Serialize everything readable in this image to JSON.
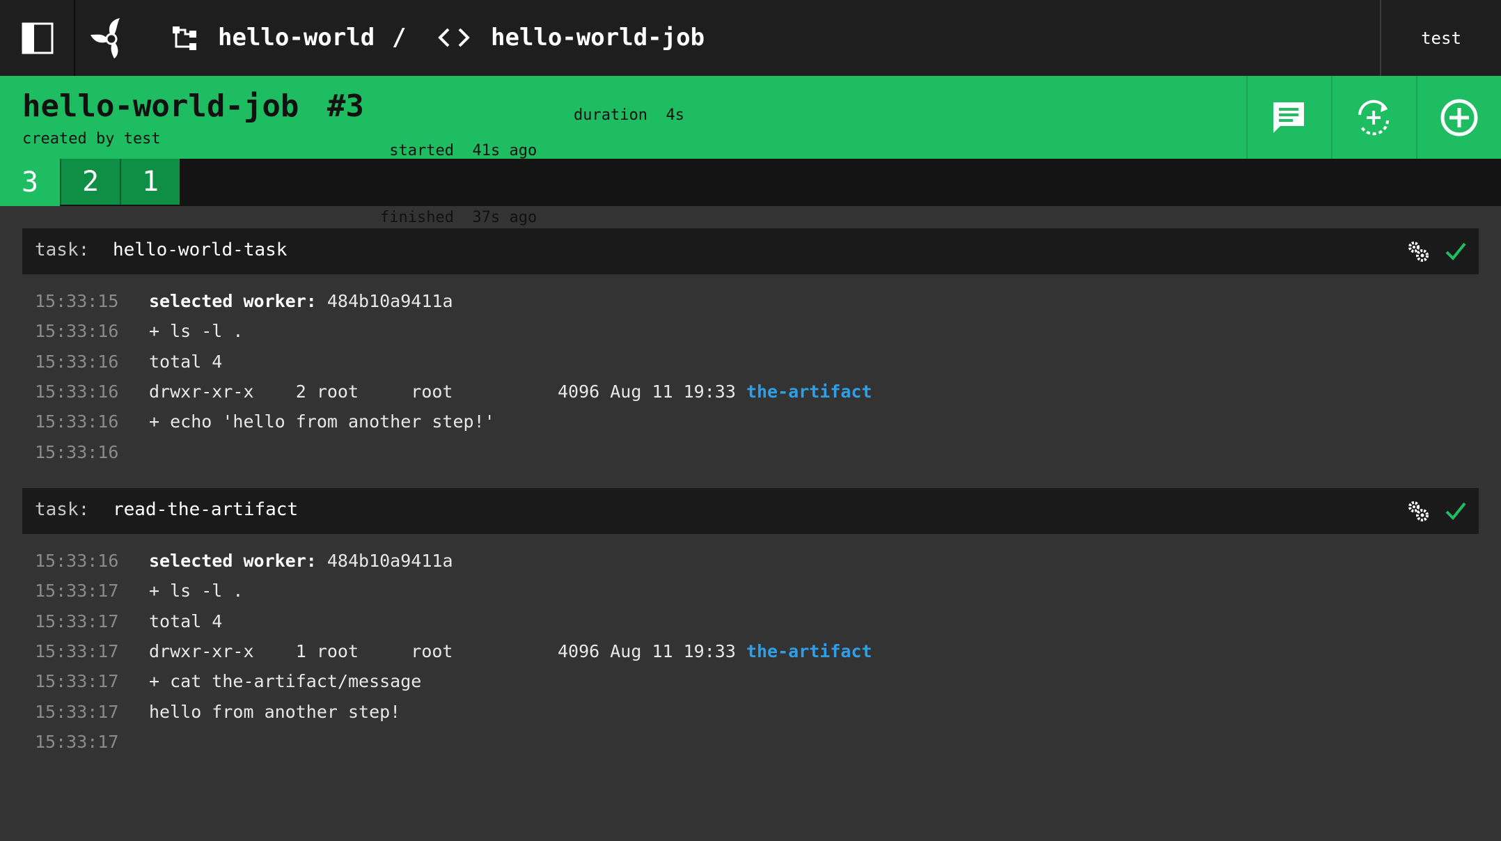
{
  "topbar": {
    "pipeline_name": "hello-world",
    "separator": "/",
    "job_name": "hello-world-job",
    "user": "test"
  },
  "build": {
    "job_name": "hello-world-job",
    "build_number": "#3",
    "created_by": "created by test",
    "started_label": "started",
    "started_value": "41s ago",
    "finished_label": "finished",
    "finished_value": "37s ago",
    "duration_label": "duration",
    "duration_value": "4s"
  },
  "build_tabs": [
    "3",
    "2",
    "1"
  ],
  "colors": {
    "succeeded": "#1fbd62",
    "link": "#2e9fe6",
    "background": "#333333"
  },
  "tasks": [
    {
      "label": "task:",
      "name": "hello-world-task",
      "status": "succeeded",
      "lines": [
        {
          "ts": "15:33:15",
          "bold": "selected worker:",
          "text": " 484b10a9411a",
          "link": ""
        },
        {
          "ts": "15:33:16",
          "bold": "",
          "text": "+ ls -l .",
          "link": ""
        },
        {
          "ts": "15:33:16",
          "bold": "",
          "text": "total 4",
          "link": ""
        },
        {
          "ts": "15:33:16",
          "bold": "",
          "text": "drwxr-xr-x    2 root     root          4096 Aug 11 19:33 ",
          "link": "the-artifact"
        },
        {
          "ts": "15:33:16",
          "bold": "",
          "text": "+ echo 'hello from another step!'",
          "link": ""
        },
        {
          "ts": "15:33:16",
          "bold": "",
          "text": "",
          "link": ""
        }
      ]
    },
    {
      "label": "task:",
      "name": "read-the-artifact",
      "status": "succeeded",
      "lines": [
        {
          "ts": "15:33:16",
          "bold": "selected worker:",
          "text": " 484b10a9411a",
          "link": ""
        },
        {
          "ts": "15:33:17",
          "bold": "",
          "text": "+ ls -l .",
          "link": ""
        },
        {
          "ts": "15:33:17",
          "bold": "",
          "text": "total 4",
          "link": ""
        },
        {
          "ts": "15:33:17",
          "bold": "",
          "text": "drwxr-xr-x    1 root     root          4096 Aug 11 19:33 ",
          "link": "the-artifact"
        },
        {
          "ts": "15:33:17",
          "bold": "",
          "text": "+ cat the-artifact/message",
          "link": ""
        },
        {
          "ts": "15:33:17",
          "bold": "",
          "text": "hello from another step!",
          "link": ""
        },
        {
          "ts": "15:33:17",
          "bold": "",
          "text": "",
          "link": ""
        }
      ]
    }
  ],
  "icons": {
    "sidebar": "sidebar-toggle-icon",
    "logo": "concourse-logo-icon",
    "pipeline": "pipeline-icon",
    "job": "code-brackets-icon",
    "comment": "comment-icon",
    "rerun": "rerun-build-icon",
    "trigger": "trigger-build-icon",
    "gear": "gears-icon",
    "check": "checkmark-icon"
  }
}
